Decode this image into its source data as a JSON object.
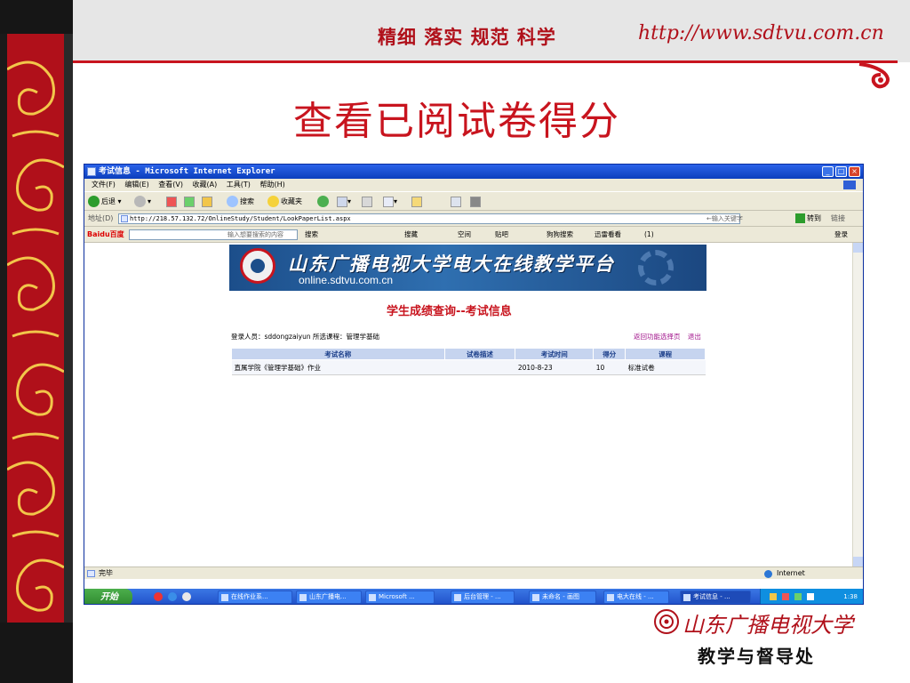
{
  "slide": {
    "motto": "精细  落实  规范  科学",
    "url": "http://www.sdtvu.com.cn",
    "title": "查看已阅试卷得分",
    "footer_logo": "山东广播电视大学",
    "footer_dept": "教学与督导处",
    "colors": {
      "accent": "#c8141e",
      "band": "#e6e6e6"
    }
  },
  "browser": {
    "window_title": "考试信息 - Microsoft Internet Explorer",
    "menu": [
      "文件(F)",
      "编辑(E)",
      "查看(V)",
      "收藏(A)",
      "工具(T)",
      "帮助(H)"
    ],
    "toolbar": {
      "back": "后退",
      "search": "搜索",
      "favorites": "收藏夹"
    },
    "address": {
      "label": "地址(D)",
      "url": "http://218.57.132.72/OnlineStudy/Student/LookPaperList.aspx",
      "hint": "←输入关键字",
      "go": "转到",
      "links": "链接"
    },
    "baidu": {
      "logo": "Baidu百度",
      "placeholder": "输入想要搜索的内容",
      "search": "搜索",
      "items": [
        "搜藏",
        "空间",
        "贴吧",
        "狗狗搜索",
        "迅雷看看",
        "(1)"
      ],
      "login": "登录"
    },
    "status": {
      "text": "完毕",
      "zone": "Internet"
    }
  },
  "page": {
    "portal_title": "山东广播电视大学电大在线教学平台",
    "portal_url": "online.sdtvu.com.cn",
    "grade_title": "学生成绩查询--考试信息",
    "login_info": "登录人员：sddongzaiyun  所选课程：管理学基础",
    "nav": {
      "back": "返回功能选择页",
      "logout": "退出"
    },
    "table": {
      "headers": [
        "考试名称",
        "试卷描述",
        "考试时间",
        "得分",
        "课程"
      ],
      "rows": [
        [
          "直属学院《管理学基础》作业",
          "",
          "2010-8-23",
          "10",
          "标准试卷"
        ]
      ]
    }
  },
  "taskbar": {
    "start": "开始",
    "tasks": [
      "在线作业系...",
      "山东广播电...",
      "Microsoft ...",
      "后台管理 - ...",
      "未命名 - 画图",
      "电大在线 - ...",
      "考试信息 - ..."
    ],
    "clock": "1:38"
  }
}
